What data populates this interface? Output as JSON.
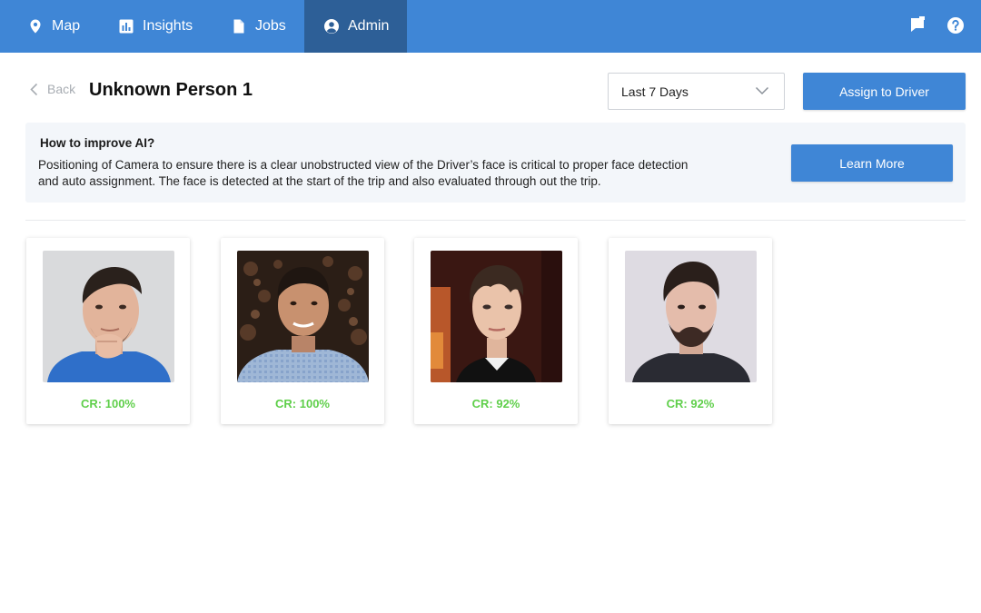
{
  "nav": {
    "items": [
      {
        "label": "Map",
        "icon": "map-pin-icon"
      },
      {
        "label": "Insights",
        "icon": "bar-chart-icon"
      },
      {
        "label": "Jobs",
        "icon": "document-icon"
      },
      {
        "label": "Admin",
        "icon": "user-circle-icon",
        "active": true
      }
    ],
    "right_icons": [
      "flag-icon",
      "help-icon"
    ]
  },
  "header": {
    "back_label": "Back",
    "title": "Unknown Person 1",
    "range_select": "Last 7 Days",
    "assign_button": "Assign to Driver"
  },
  "info": {
    "title": "How to improve AI?",
    "text": "Positioning of Camera to ensure there is a clear unobstructed view of the Driver’s face is critical to proper face detection and auto assignment. The face is detected at the start of the trip and also evaluated through out the trip.",
    "learn_button": "Learn More"
  },
  "faces": [
    {
      "cr": "CR: 100%"
    },
    {
      "cr": "CR: 100%"
    },
    {
      "cr": "CR: 92%"
    },
    {
      "cr": "CR: 92%"
    }
  ],
  "colors": {
    "nav_bg": "#3f86d6",
    "nav_active": "#2d5f97",
    "button": "#3f86d6",
    "cr_text": "#5fcf4a",
    "info_bg": "#f3f6fa"
  }
}
